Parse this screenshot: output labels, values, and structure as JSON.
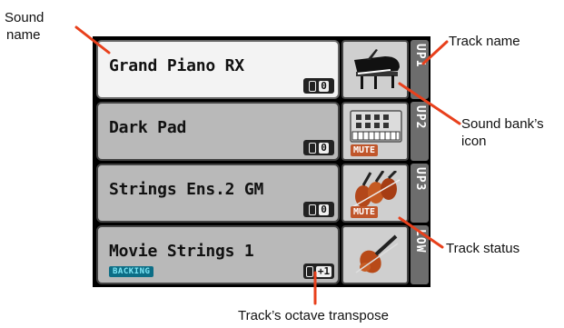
{
  "tracks": [
    {
      "sound": "Grand Piano RX",
      "track": "UP1",
      "octave": "0",
      "status": "",
      "backing": ""
    },
    {
      "sound": "Dark Pad",
      "track": "UP2",
      "octave": "0",
      "status": "MUTE",
      "backing": ""
    },
    {
      "sound": "Strings Ens.2 GM",
      "track": "UP3",
      "octave": "0",
      "status": "MUTE",
      "backing": ""
    },
    {
      "sound": "Movie Strings 1",
      "track": "LOW",
      "octave": "+1",
      "status": "",
      "backing": "BACKING"
    }
  ],
  "callouts": {
    "sound_name_line1": "Sound",
    "sound_name_line2": "name",
    "track_name": "Track name",
    "bank_icon_line1": "Sound bank’s",
    "bank_icon_line2": "icon",
    "track_status": "Track status",
    "octave_transpose": "Track’s octave transpose"
  },
  "colors": {
    "callout_arrow": "#e8401c",
    "mute": "#c0562b",
    "backing": "#0d6e86"
  }
}
